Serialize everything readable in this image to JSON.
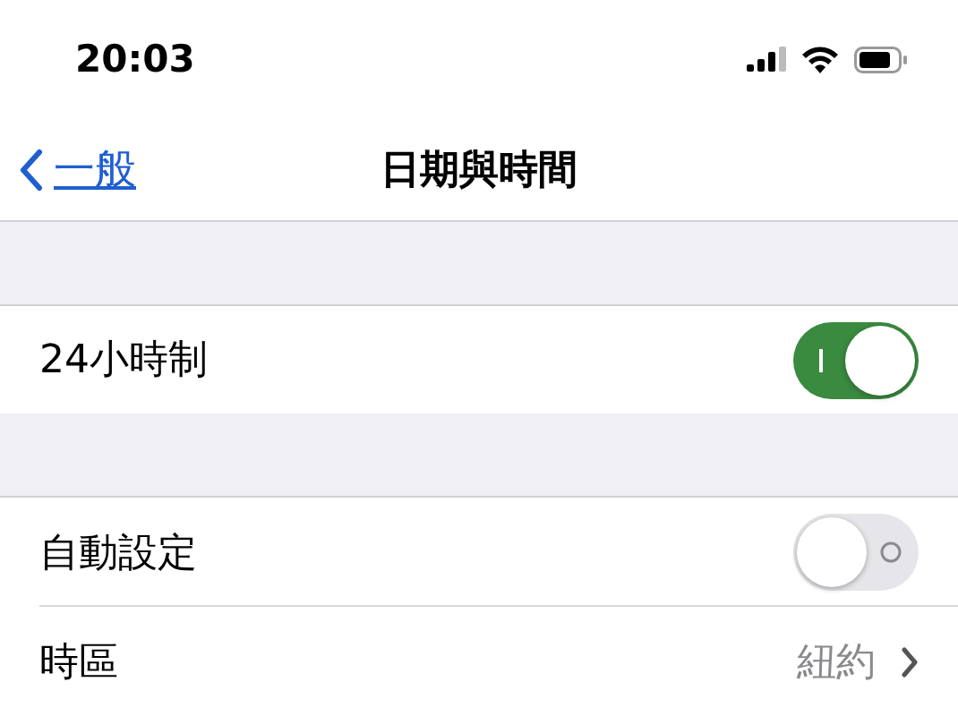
{
  "status_bar": {
    "time": "20:03"
  },
  "nav": {
    "back": "一般",
    "title": "日期與時間"
  },
  "sections": [
    {
      "rows": [
        {
          "kind": "toggle",
          "label": "24小時制",
          "on": true
        }
      ]
    },
    {
      "rows": [
        {
          "kind": "toggle",
          "label": "自動設定",
          "on": false
        },
        {
          "kind": "link",
          "label": "時區",
          "value": "紐約"
        }
      ]
    }
  ]
}
